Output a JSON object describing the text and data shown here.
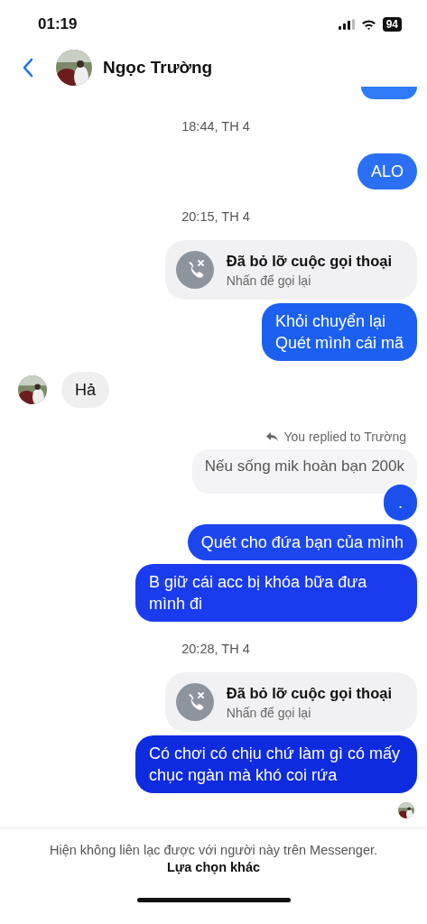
{
  "status_bar": {
    "time": "01:19",
    "battery": "94"
  },
  "header": {
    "name": "Ngọc Trường"
  },
  "messages": [
    {
      "kind": "cut_bubble",
      "color": "#2f7af7"
    },
    {
      "kind": "timestamp",
      "text": "18:44, TH 4"
    },
    {
      "kind": "sent",
      "text": "ALO",
      "color": "#2b6ff4"
    },
    {
      "kind": "timestamp",
      "text": "20:15, TH 4"
    },
    {
      "kind": "call",
      "title": "Đã bỏ lỡ cuộc gọi thoại",
      "subtitle": "Nhấn để gọi lại"
    },
    {
      "kind": "sent",
      "text": "Khỏi chuyển lại\nQuét mình cái mã",
      "color": "#1c60f1"
    },
    {
      "kind": "received",
      "text": "Hả"
    },
    {
      "kind": "reply_label",
      "text": "You replied to Trường"
    },
    {
      "kind": "quoted",
      "text": "Nếu sống mik hoàn bạn 200k"
    },
    {
      "kind": "sent",
      "text": ".",
      "color": "#1b50ef"
    },
    {
      "kind": "sent",
      "text": "Quét cho đứa bạn của mình",
      "color": "#1d47ee"
    },
    {
      "kind": "sent",
      "text": "B giữ cái acc bị khóa bữa đưa mình đi",
      "color": "#1a3cee"
    },
    {
      "kind": "timestamp",
      "text": "20:28, TH 4"
    },
    {
      "kind": "call",
      "title": "Đã bỏ lỡ cuộc gọi thoại",
      "subtitle": "Nhấn để gọi lại"
    },
    {
      "kind": "sent",
      "text": "Có chơi có chịu chứ làm gì có mấy chục ngàn mà khó coi rứa",
      "color": "#0f2bdf"
    },
    {
      "kind": "seen"
    }
  ],
  "footer": {
    "notice": "Hiện không liên lạc được với người này trên Messenger.",
    "link": "Lựa chọn khác"
  }
}
